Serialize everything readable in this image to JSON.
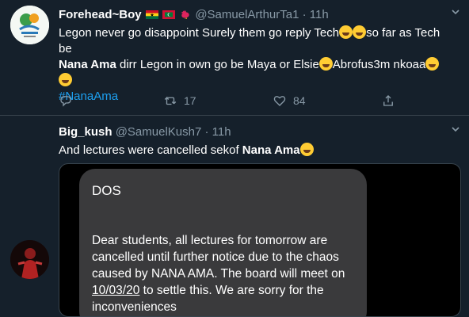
{
  "tweets": [
    {
      "name": "Forehead~Boy",
      "handle": "@SamuelArthurTa1",
      "sep": "·",
      "time": "11h",
      "text": {
        "a": "Legon never go disappoint Surely them go reply Tech",
        "b": "so far as Tech be",
        "c": "Nana Ama",
        "d": "  dirr Legon in own go be Maya or Elsie",
        "e": "Abrofus3m nkoaa",
        "hashtag": "#NanaAma"
      },
      "replies": "",
      "retweets": "17",
      "likes": "84"
    },
    {
      "name": "Big_kush",
      "handle": "@SamuelKush7",
      "sep": "·",
      "time": "11h",
      "text": {
        "a": "And lectures were cancelled sekof ",
        "b": "Nana Ama"
      },
      "sms": {
        "from": "DOS",
        "line1": "Dear students, all lectures for tomorrow are cancelled until further notice due to the chaos caused by NANA AMA. The board will meet on ",
        "date": "10/03/20",
        "line2": " to settle this. We are sorry for the inconveniences"
      }
    }
  ],
  "colors": {
    "background": "#15202b",
    "secondary_text": "#8899a6",
    "link": "#1da1f2",
    "divider": "#38444d"
  },
  "icons": [
    "ghana-flag-icon",
    "maldives-flag-icon",
    "rooster-icon",
    "joy-emoji-icon",
    "reply-icon",
    "retweet-icon",
    "like-icon",
    "share-icon",
    "chevron-down-icon"
  ]
}
